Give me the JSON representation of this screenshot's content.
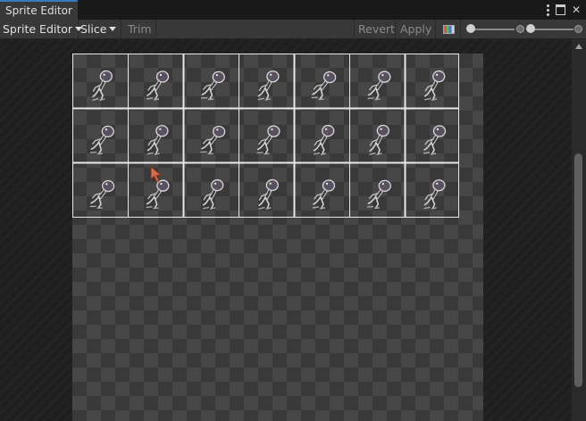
{
  "window": {
    "tab_title": "Sprite Editor",
    "icons": [
      "kebab-menu-icon",
      "maximize-icon",
      "close-icon"
    ],
    "close_glyph": "✕"
  },
  "toolbar": {
    "mode_dropdown": "Sprite Editor",
    "slice_dropdown": "Slice",
    "trim_button": "Trim",
    "revert_button": "Revert",
    "apply_button": "Apply",
    "color_channel_icon": "rgb-toggle-icon",
    "alpha_slider_value": 0.0,
    "zoom_slider_value": 0.1
  },
  "sprite_sheet": {
    "rows": 3,
    "columns": 7,
    "frame_icon": "walking-character-sprite",
    "accent": "#e8e8e8",
    "checker_light": "#474747",
    "checker_dark": "#393939"
  },
  "cursor": {
    "icon": "pointer-cursor-icon",
    "color": "#d96b4a"
  }
}
